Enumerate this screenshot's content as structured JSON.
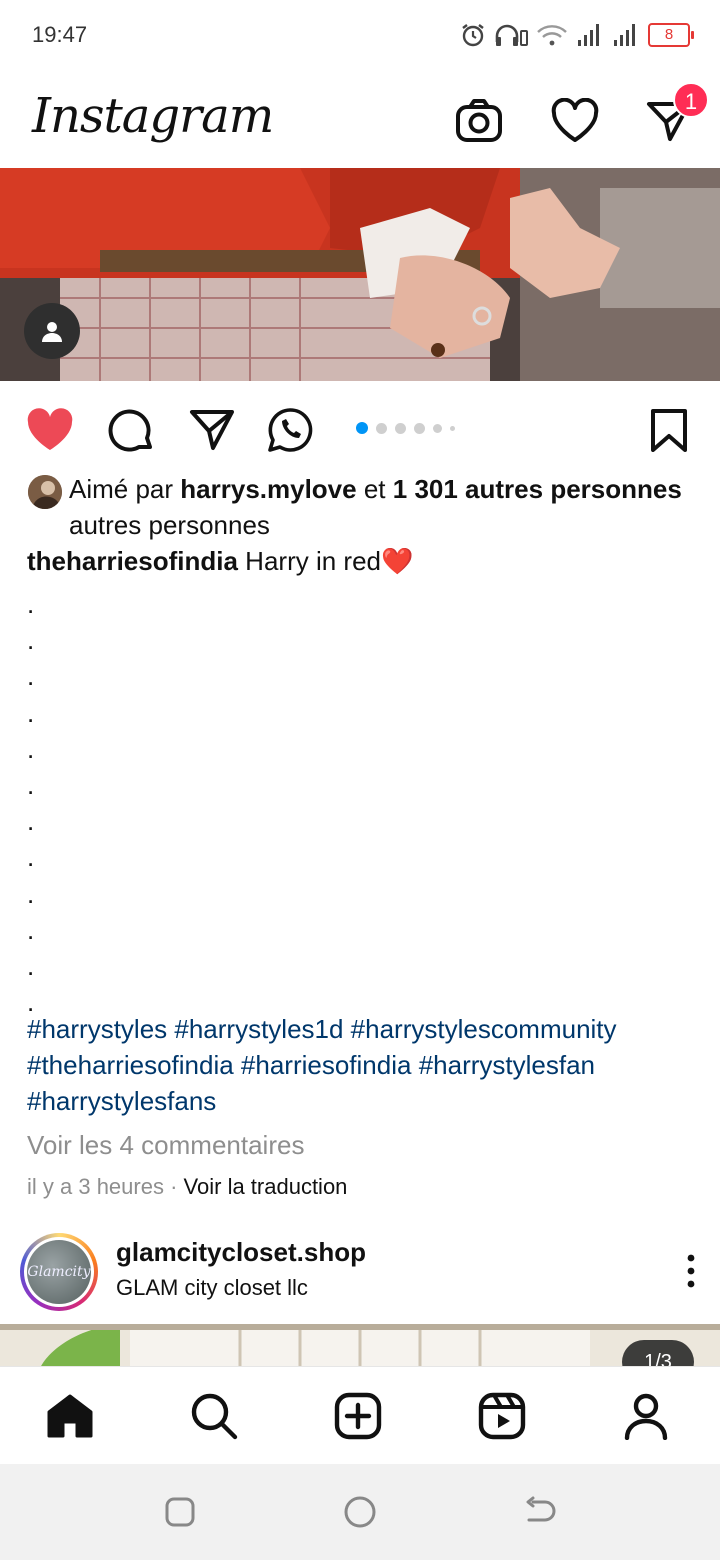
{
  "status_bar": {
    "time": "19:47",
    "battery": "8"
  },
  "header": {
    "logo": "Instagram",
    "notification_count": "1"
  },
  "post": {
    "likes_prefix": "Aimé par",
    "liker": "harrys.mylove",
    "likes_and": "et",
    "likes_count": "1 301 autres personnes",
    "likes_suffix": "autres personnes",
    "author": "theharriesofindia",
    "caption": "Harry in red❤️",
    "caption_dots": [
      ".",
      ".",
      ".",
      ".",
      ".",
      ".",
      ".",
      ".",
      ".",
      ".",
      ".",
      "."
    ],
    "hashtags_line1": "#harrystyles #harrystyles1d #harrystylescommunity",
    "hashtags_line2": "#theharriesofindia #harriesofindia #harrystylesfan",
    "hashtags_line3": "#harrystylesfans",
    "view_comments": "Voir les 4 commentaires",
    "time_ago": "il y a 3 heures",
    "separator": "·",
    "translate": "Voir la traduction",
    "carousel": {
      "count": 6,
      "active_index": 0
    }
  },
  "next_post": {
    "username": "glamcitycloset.shop",
    "subtitle": "GLAM city closet llc",
    "avatar_text": "Glamcity",
    "counter": "1/3"
  },
  "icons": {
    "header": [
      "camera-icon",
      "heart-icon",
      "direct-send-icon"
    ],
    "actions": [
      "like-icon",
      "comment-icon",
      "share-icon",
      "whatsapp-icon",
      "bookmark-icon"
    ],
    "nav": [
      "home-icon",
      "search-icon",
      "create-icon",
      "reels-icon",
      "profile-icon"
    ],
    "system": [
      "recents-icon",
      "home-circle-icon",
      "back-icon"
    ]
  },
  "colors": {
    "like": "#ed4956",
    "hashtag": "#00376b",
    "badge": "#ff2d55",
    "active_dot": "#0095f6"
  }
}
